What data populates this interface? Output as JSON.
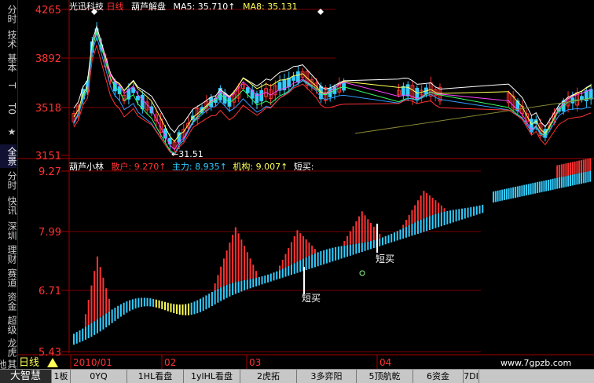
{
  "sidebar": {
    "tabs": [
      "分时",
      "技术",
      "基本",
      "T",
      "T0",
      "★",
      "全景",
      "分时",
      "快讯",
      "深圳",
      "理财",
      "赛道",
      "资金",
      "超级",
      "龙虎",
      "其他"
    ]
  },
  "header": {
    "stock_name": "光迅科技",
    "period": "日线",
    "indicator_name": "葫芦解盘",
    "ma5_label": "MA5:",
    "ma5_value": "35.710↑",
    "ma8_label": "MA8:",
    "ma8_value": "35.131"
  },
  "upper_axis": {
    "labels": [
      "4265",
      "3892",
      "3518",
      "3151"
    ]
  },
  "upper_annotation": "←31.51",
  "lower_header": {
    "name": "葫芦小林",
    "retail_label": "散户:",
    "retail_value": "9.270↑",
    "main_label": "主力:",
    "main_value": "8.935↑",
    "inst_label": "机构:",
    "inst_value": "9.007↑",
    "short_label": "短买:"
  },
  "lower_axis": {
    "labels": [
      "9.27",
      "7.99",
      "6.71",
      "5.43"
    ]
  },
  "signals": [
    "短买",
    "短买"
  ],
  "timeline": {
    "period_label": "日线",
    "dates": [
      "2010/01",
      "02",
      "03",
      "04"
    ],
    "watermark": "www.7gpzb.com"
  },
  "bottom_tabs": [
    "大智慧",
    "1板",
    "0YQ",
    "1HL看盘",
    "1ylHL看盘",
    "2虎拓",
    "3多弈阳",
    "5顶航乾",
    "6资金",
    "7DI"
  ],
  "colors": {
    "up": "#ff3232",
    "down": "#33ccff",
    "retail": "#ff3232",
    "main": "#33ccff",
    "inst": "#ffff55",
    "frame": "#a00000"
  },
  "chart_data": [
    {
      "type": "candlestick",
      "title": "光迅科技 日线",
      "ylim": [
        3151,
        4265
      ],
      "yticks": [
        4265,
        3892,
        3518,
        3151
      ],
      "series": [
        {
          "name": "MA5",
          "last": 35.71
        },
        {
          "name": "MA8",
          "last": 35.131
        }
      ],
      "annotations": [
        "←31.51"
      ]
    },
    {
      "type": "bar",
      "title": "葫芦小林",
      "ylim": [
        5.43,
        9.27
      ],
      "yticks": [
        9.27,
        7.99,
        6.71,
        5.43
      ],
      "series": [
        {
          "name": "散户",
          "last": 9.27
        },
        {
          "name": "主力",
          "last": 8.935
        },
        {
          "name": "机构",
          "last": 9.007
        }
      ],
      "annotations": [
        "短买",
        "短买"
      ]
    }
  ]
}
